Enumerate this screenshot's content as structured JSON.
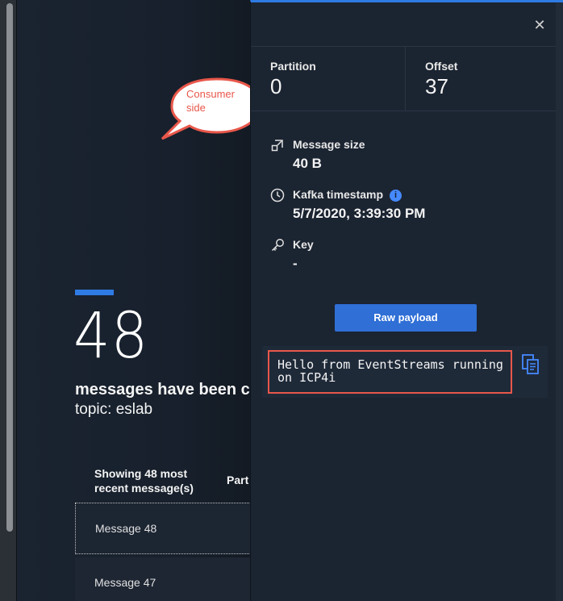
{
  "callout": {
    "text": "Consumer side",
    "color": "#e8574a"
  },
  "summary": {
    "count": "48",
    "consumed_text": "messages have been co",
    "topic_text": "topic: eslab"
  },
  "table": {
    "header_showing": "Showing 48 most recent message(s)",
    "header_partition": "Part",
    "rows": [
      {
        "label": "Message 48",
        "selected": true
      },
      {
        "label": "Message 47",
        "selected": false
      }
    ]
  },
  "panel": {
    "close_icon": "close-icon",
    "partition": {
      "label": "Partition",
      "value": "0"
    },
    "offset": {
      "label": "Offset",
      "value": "37"
    },
    "message_size": {
      "label": "Message size",
      "value": "40 B",
      "icon": "resize-icon"
    },
    "kafka_timestamp": {
      "label": "Kafka timestamp",
      "value": "5/7/2020, 3:39:30 PM",
      "icon": "clock-icon",
      "info": "i"
    },
    "key": {
      "label": "Key",
      "value": "-",
      "icon": "key-icon"
    },
    "raw_payload_button": "Raw payload",
    "payload": "Hello from EventStreams running on ICP4i",
    "copy_icon": "copy-icon"
  },
  "colors": {
    "accent": "#2f7be4",
    "highlight": "#e8574a",
    "panel_bg": "#1b2431"
  }
}
